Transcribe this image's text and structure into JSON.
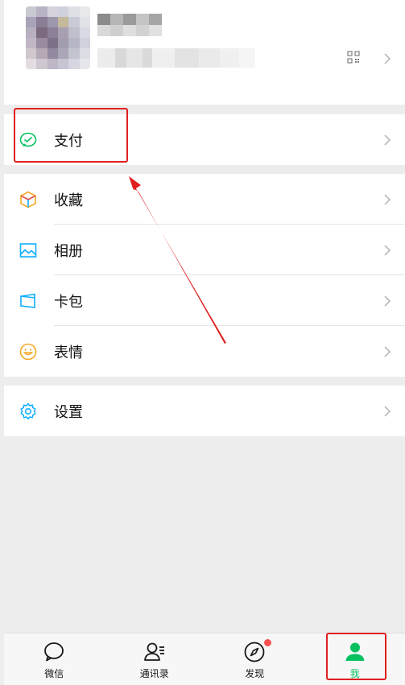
{
  "menu": {
    "pay": {
      "label": "支付",
      "icon": "wechat-pay-icon"
    },
    "items": [
      {
        "key": "favorites",
        "label": "收藏",
        "icon": "cube-icon"
      },
      {
        "key": "album",
        "label": "相册",
        "icon": "image-icon"
      },
      {
        "key": "cards",
        "label": "卡包",
        "icon": "wallet-icon"
      },
      {
        "key": "stickers",
        "label": "表情",
        "icon": "smiley-icon"
      }
    ],
    "settings": {
      "label": "设置",
      "icon": "gear-icon"
    }
  },
  "tabbar": {
    "tabs": [
      {
        "label": "微信",
        "icon": "chat-bubble-icon",
        "active": false
      },
      {
        "label": "通讯录",
        "icon": "contacts-icon",
        "active": false
      },
      {
        "label": "发现",
        "icon": "compass-icon",
        "active": false,
        "badge": true
      },
      {
        "label": "我",
        "icon": "person-icon",
        "active": true
      }
    ]
  },
  "colors": {
    "accent_green": "#07c160",
    "annotation_red": "#e02020",
    "badge_red": "#fa5151"
  }
}
